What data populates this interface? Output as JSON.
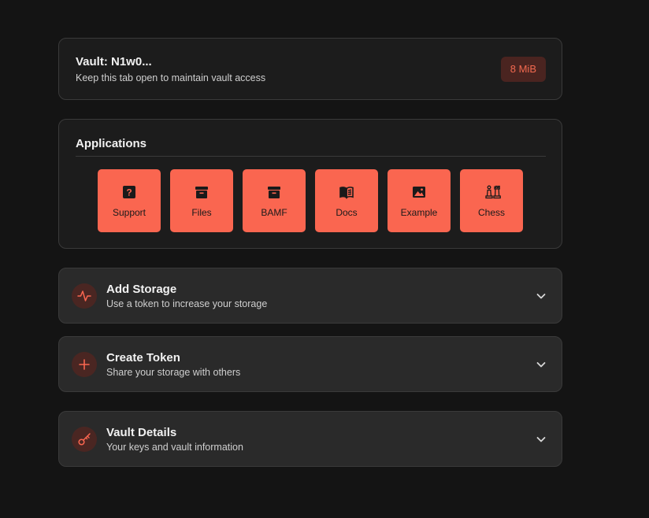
{
  "vault": {
    "title": "Vault: N1w0...",
    "subtitle": "Keep this tab open to maintain vault access",
    "storage_badge": "8 MiB"
  },
  "applications": {
    "title": "Applications",
    "items": [
      {
        "label": "Support",
        "icon": "question-icon"
      },
      {
        "label": "Files",
        "icon": "archive-icon"
      },
      {
        "label": "BAMF",
        "icon": "archive-icon"
      },
      {
        "label": "Docs",
        "icon": "book-icon"
      },
      {
        "label": "Example",
        "icon": "image-icon"
      },
      {
        "label": "Chess",
        "icon": "chess-icon"
      }
    ]
  },
  "sections": [
    {
      "title": "Add Storage",
      "subtitle": "Use a token to increase your storage",
      "icon": "activity-icon"
    },
    {
      "title": "Create Token",
      "subtitle": "Share your storage with others",
      "icon": "plus-icon"
    },
    {
      "title": "Vault Details",
      "subtitle": "Your keys and vault information",
      "icon": "key-icon"
    }
  ],
  "colors": {
    "background": "#141414",
    "accent": "#fa6650",
    "badge_bg": "#4a2420"
  }
}
